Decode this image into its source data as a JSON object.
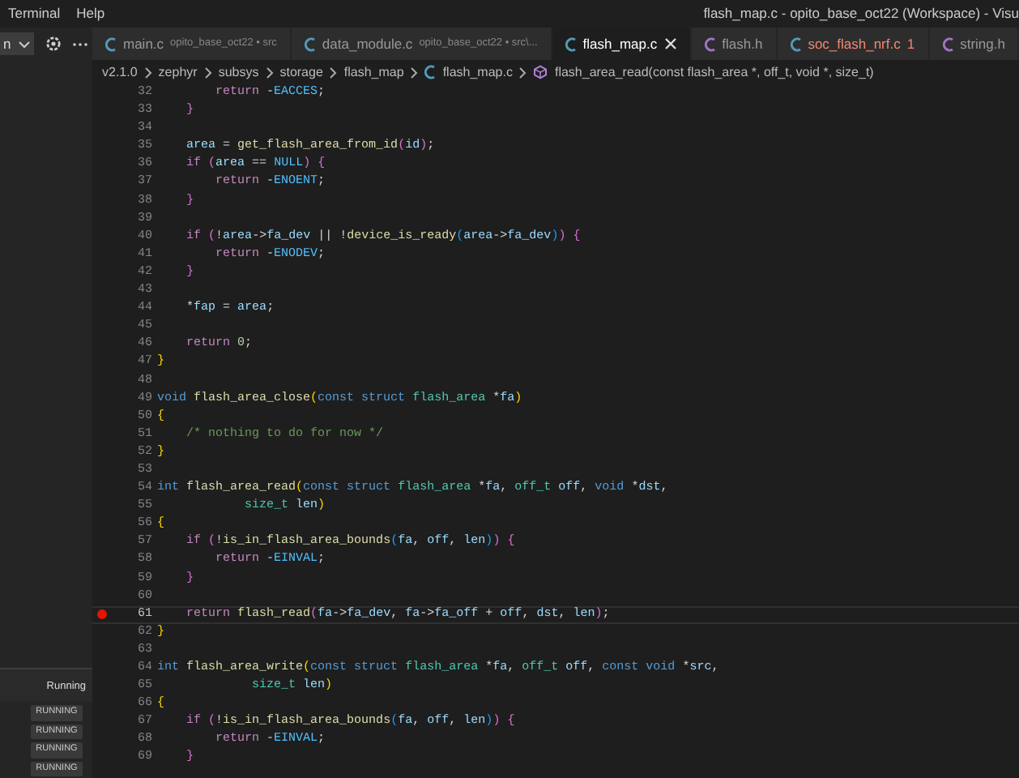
{
  "menu": [
    "Terminal",
    "Help"
  ],
  "window": {
    "title": "flash_map.c - opito_base_oct22 (Workspace) - Visu"
  },
  "sidebar": {
    "dropdown": "n",
    "section_title": "Running",
    "badges": [
      "RUNNING",
      "RUNNING",
      "RUNNING",
      "RUNNING"
    ]
  },
  "tabs": [
    {
      "label": "main.c",
      "kind": "c",
      "description": "opito_base_oct22 • src",
      "selected": false,
      "error": false
    },
    {
      "label": "data_module.c",
      "kind": "c",
      "description": "opito_base_oct22 • src\\...",
      "selected": false,
      "error": false
    },
    {
      "label": "flash_map.c",
      "kind": "c",
      "selected": true,
      "error": false
    },
    {
      "label": "flash.h",
      "kind": "h",
      "selected": false,
      "error": false
    },
    {
      "label": "soc_flash_nrf.c",
      "kind": "c",
      "badge": "1",
      "selected": false,
      "error": true
    },
    {
      "label": "string.h",
      "kind": "h",
      "selected": false,
      "error": false
    }
  ],
  "breadcrumbs": [
    {
      "label": "v2.1.0",
      "kind": "folder"
    },
    {
      "label": "zephyr",
      "kind": "folder"
    },
    {
      "label": "subsys",
      "kind": "folder"
    },
    {
      "label": "storage",
      "kind": "folder"
    },
    {
      "label": "flash_map",
      "kind": "folder"
    },
    {
      "label": "flash_map.c",
      "kind": "file"
    },
    {
      "label": "flash_area_read(const flash_area *, off_t, void *, size_t)",
      "kind": "symbol"
    }
  ],
  "code": [
    {
      "number": "32",
      "breakpoint": false,
      "current": false,
      "tokens": [
        {
          "kind": "ctl",
          "text": "        return"
        },
        {
          "kind": "p",
          "text": " -"
        },
        {
          "kind": "macro",
          "text": "EACCES"
        },
        {
          "kind": "p",
          "text": ";"
        }
      ]
    },
    {
      "number": "33",
      "breakpoint": false,
      "current": false,
      "tokens": [
        {
          "kind": "b2",
          "text": "    }"
        }
      ]
    },
    {
      "number": "34",
      "breakpoint": false,
      "current": false
    },
    {
      "number": "35",
      "breakpoint": false,
      "current": false,
      "tokens": [
        {
          "kind": "var",
          "text": "    area"
        },
        {
          "kind": "p",
          "text": " = "
        },
        {
          "kind": "fn",
          "text": "get_flash_area_from_id"
        },
        {
          "kind": "b2",
          "text": "("
        },
        {
          "kind": "var",
          "text": "id"
        },
        {
          "kind": "b2",
          "text": ")"
        },
        {
          "kind": "p",
          "text": ";"
        }
      ]
    },
    {
      "number": "36",
      "breakpoint": false,
      "current": false,
      "tokens": [
        {
          "kind": "ctl",
          "text": "    if"
        },
        {
          "kind": "b2",
          "text": " ("
        },
        {
          "kind": "var",
          "text": "area"
        },
        {
          "kind": "p",
          "text": " == "
        },
        {
          "kind": "macro",
          "text": "NULL"
        },
        {
          "kind": "b2",
          "text": ") {"
        }
      ]
    },
    {
      "number": "37",
      "breakpoint": false,
      "current": false,
      "tokens": [
        {
          "kind": "ctl",
          "text": "        return"
        },
        {
          "kind": "p",
          "text": " -"
        },
        {
          "kind": "macro",
          "text": "ENOENT"
        },
        {
          "kind": "p",
          "text": ";"
        }
      ]
    },
    {
      "number": "38",
      "breakpoint": false,
      "current": false,
      "tokens": [
        {
          "kind": "b2",
          "text": "    }"
        }
      ]
    },
    {
      "number": "39",
      "breakpoint": false,
      "current": false
    },
    {
      "number": "40",
      "breakpoint": false,
      "current": false,
      "tokens": [
        {
          "kind": "ctl",
          "text": "    if"
        },
        {
          "kind": "b2",
          "text": " ("
        },
        {
          "kind": "p",
          "text": "!"
        },
        {
          "kind": "var",
          "text": "area"
        },
        {
          "kind": "p",
          "text": "->"
        },
        {
          "kind": "var",
          "text": "fa_dev"
        },
        {
          "kind": "p",
          "text": " || !"
        },
        {
          "kind": "fn",
          "text": "device_is_ready"
        },
        {
          "kind": "b3",
          "text": "("
        },
        {
          "kind": "var",
          "text": "area"
        },
        {
          "kind": "p",
          "text": "->"
        },
        {
          "kind": "var",
          "text": "fa_dev"
        },
        {
          "kind": "b3",
          "text": ")"
        },
        {
          "kind": "b2",
          "text": ") {"
        }
      ]
    },
    {
      "number": "41",
      "breakpoint": false,
      "current": false,
      "tokens": [
        {
          "kind": "ctl",
          "text": "        return"
        },
        {
          "kind": "p",
          "text": " -"
        },
        {
          "kind": "macro",
          "text": "ENODEV"
        },
        {
          "kind": "p",
          "text": ";"
        }
      ]
    },
    {
      "number": "42",
      "breakpoint": false,
      "current": false,
      "tokens": [
        {
          "kind": "b2",
          "text": "    }"
        }
      ]
    },
    {
      "number": "43",
      "breakpoint": false,
      "current": false
    },
    {
      "number": "44",
      "breakpoint": false,
      "current": false,
      "tokens": [
        {
          "kind": "p",
          "text": "    *"
        },
        {
          "kind": "var",
          "text": "fap"
        },
        {
          "kind": "p",
          "text": " = "
        },
        {
          "kind": "var",
          "text": "area"
        },
        {
          "kind": "p",
          "text": ";"
        }
      ]
    },
    {
      "number": "45",
      "breakpoint": false,
      "current": false
    },
    {
      "number": "46",
      "breakpoint": false,
      "current": false,
      "tokens": [
        {
          "kind": "ctl",
          "text": "    return"
        },
        {
          "kind": "num",
          "text": " 0"
        },
        {
          "kind": "p",
          "text": ";"
        }
      ]
    },
    {
      "number": "47",
      "breakpoint": false,
      "current": false,
      "tokens": [
        {
          "kind": "b1",
          "text": "}"
        }
      ]
    },
    {
      "number": "48",
      "breakpoint": false,
      "current": false
    },
    {
      "number": "49",
      "breakpoint": false,
      "current": false,
      "tokens": [
        {
          "kind": "kw",
          "text": "void"
        },
        {
          "kind": "fn",
          "text": " flash_area_close"
        },
        {
          "kind": "b1",
          "text": "("
        },
        {
          "kind": "kw",
          "text": "const struct"
        },
        {
          "kind": "type",
          "text": " flash_area"
        },
        {
          "kind": "p",
          "text": " *"
        },
        {
          "kind": "var",
          "text": "fa"
        },
        {
          "kind": "b1",
          "text": ")"
        }
      ]
    },
    {
      "number": "50",
      "breakpoint": false,
      "current": false,
      "tokens": [
        {
          "kind": "b1",
          "text": "{"
        }
      ]
    },
    {
      "number": "51",
      "breakpoint": false,
      "current": false,
      "tokens": [
        {
          "kind": "cmt",
          "text": "    /* nothing to do for now */"
        }
      ]
    },
    {
      "number": "52",
      "breakpoint": false,
      "current": false,
      "tokens": [
        {
          "kind": "b1",
          "text": "}"
        }
      ]
    },
    {
      "number": "53",
      "breakpoint": false,
      "current": false
    },
    {
      "number": "54",
      "breakpoint": false,
      "current": false,
      "tokens": [
        {
          "kind": "kw",
          "text": "int"
        },
        {
          "kind": "fn",
          "text": " flash_area_read"
        },
        {
          "kind": "b1",
          "text": "("
        },
        {
          "kind": "kw",
          "text": "const struct"
        },
        {
          "kind": "type",
          "text": " flash_area"
        },
        {
          "kind": "p",
          "text": " *"
        },
        {
          "kind": "var",
          "text": "fa"
        },
        {
          "kind": "p",
          "text": ", "
        },
        {
          "kind": "type",
          "text": "off_t"
        },
        {
          "kind": "var",
          "text": " off"
        },
        {
          "kind": "p",
          "text": ", "
        },
        {
          "kind": "kw",
          "text": "void"
        },
        {
          "kind": "p",
          "text": " *"
        },
        {
          "kind": "var",
          "text": "dst"
        },
        {
          "kind": "p",
          "text": ","
        }
      ]
    },
    {
      "number": "55",
      "breakpoint": false,
      "current": false,
      "tokens": [
        {
          "kind": "type",
          "text": "            size_t"
        },
        {
          "kind": "var",
          "text": " len"
        },
        {
          "kind": "b1",
          "text": ")"
        }
      ]
    },
    {
      "number": "56",
      "breakpoint": false,
      "current": false,
      "tokens": [
        {
          "kind": "b1",
          "text": "{"
        }
      ]
    },
    {
      "number": "57",
      "breakpoint": false,
      "current": false,
      "tokens": [
        {
          "kind": "ctl",
          "text": "    if"
        },
        {
          "kind": "b2",
          "text": " ("
        },
        {
          "kind": "p",
          "text": "!"
        },
        {
          "kind": "fn",
          "text": "is_in_flash_area_bounds"
        },
        {
          "kind": "b3",
          "text": "("
        },
        {
          "kind": "var",
          "text": "fa"
        },
        {
          "kind": "p",
          "text": ", "
        },
        {
          "kind": "var",
          "text": "off"
        },
        {
          "kind": "p",
          "text": ", "
        },
        {
          "kind": "var",
          "text": "len"
        },
        {
          "kind": "b3",
          "text": ")"
        },
        {
          "kind": "b2",
          "text": ") {"
        }
      ]
    },
    {
      "number": "58",
      "breakpoint": false,
      "current": false,
      "tokens": [
        {
          "kind": "ctl",
          "text": "        return"
        },
        {
          "kind": "p",
          "text": " -"
        },
        {
          "kind": "macro",
          "text": "EINVAL"
        },
        {
          "kind": "p",
          "text": ";"
        }
      ]
    },
    {
      "number": "59",
      "breakpoint": false,
      "current": false,
      "tokens": [
        {
          "kind": "b2",
          "text": "    }"
        }
      ]
    },
    {
      "number": "60",
      "breakpoint": false,
      "current": false
    },
    {
      "number": "61",
      "breakpoint": true,
      "current": true,
      "tokens": [
        {
          "kind": "ctl",
          "text": "    return"
        },
        {
          "kind": "fn",
          "text": " flash_read"
        },
        {
          "kind": "b2",
          "text": "("
        },
        {
          "kind": "var",
          "text": "fa"
        },
        {
          "kind": "p",
          "text": "->"
        },
        {
          "kind": "var",
          "text": "fa_dev"
        },
        {
          "kind": "p",
          "text": ", "
        },
        {
          "kind": "var",
          "text": "fa"
        },
        {
          "kind": "p",
          "text": "->"
        },
        {
          "kind": "var",
          "text": "fa_off"
        },
        {
          "kind": "p",
          "text": " + "
        },
        {
          "kind": "var",
          "text": "off"
        },
        {
          "kind": "p",
          "text": ", "
        },
        {
          "kind": "var",
          "text": "dst"
        },
        {
          "kind": "p",
          "text": ", "
        },
        {
          "kind": "var",
          "text": "len"
        },
        {
          "kind": "b2",
          "text": ")"
        },
        {
          "kind": "p",
          "text": ";"
        }
      ]
    },
    {
      "number": "62",
      "breakpoint": false,
      "current": false,
      "tokens": [
        {
          "kind": "b1",
          "text": "}"
        }
      ]
    },
    {
      "number": "63",
      "breakpoint": false,
      "current": false
    },
    {
      "number": "64",
      "breakpoint": false,
      "current": false,
      "tokens": [
        {
          "kind": "kw",
          "text": "int"
        },
        {
          "kind": "fn",
          "text": " flash_area_write"
        },
        {
          "kind": "b1",
          "text": "("
        },
        {
          "kind": "kw",
          "text": "const struct"
        },
        {
          "kind": "type",
          "text": " flash_area"
        },
        {
          "kind": "p",
          "text": " *"
        },
        {
          "kind": "var",
          "text": "fa"
        },
        {
          "kind": "p",
          "text": ", "
        },
        {
          "kind": "type",
          "text": "off_t"
        },
        {
          "kind": "var",
          "text": " off"
        },
        {
          "kind": "p",
          "text": ", "
        },
        {
          "kind": "kw",
          "text": "const void"
        },
        {
          "kind": "p",
          "text": " *"
        },
        {
          "kind": "var",
          "text": "src"
        },
        {
          "kind": "p",
          "text": ","
        }
      ]
    },
    {
      "number": "65",
      "breakpoint": false,
      "current": false,
      "tokens": [
        {
          "kind": "type",
          "text": "             size_t"
        },
        {
          "kind": "var",
          "text": " len"
        },
        {
          "kind": "b1",
          "text": ")"
        }
      ]
    },
    {
      "number": "66",
      "breakpoint": false,
      "current": false,
      "tokens": [
        {
          "kind": "b1",
          "text": "{"
        }
      ]
    },
    {
      "number": "67",
      "breakpoint": false,
      "current": false,
      "tokens": [
        {
          "kind": "ctl",
          "text": "    if"
        },
        {
          "kind": "b2",
          "text": " ("
        },
        {
          "kind": "p",
          "text": "!"
        },
        {
          "kind": "fn",
          "text": "is_in_flash_area_bounds"
        },
        {
          "kind": "b3",
          "text": "("
        },
        {
          "kind": "var",
          "text": "fa"
        },
        {
          "kind": "p",
          "text": ", "
        },
        {
          "kind": "var",
          "text": "off"
        },
        {
          "kind": "p",
          "text": ", "
        },
        {
          "kind": "var",
          "text": "len"
        },
        {
          "kind": "b3",
          "text": ")"
        },
        {
          "kind": "b2",
          "text": ") {"
        }
      ]
    },
    {
      "number": "68",
      "breakpoint": false,
      "current": false,
      "tokens": [
        {
          "kind": "ctl",
          "text": "        return"
        },
        {
          "kind": "p",
          "text": " -"
        },
        {
          "kind": "macro",
          "text": "EINVAL"
        },
        {
          "kind": "p",
          "text": ";"
        }
      ]
    },
    {
      "number": "69",
      "breakpoint": false,
      "current": false,
      "tokens": [
        {
          "kind": "b2",
          "text": "    }"
        }
      ]
    }
  ]
}
